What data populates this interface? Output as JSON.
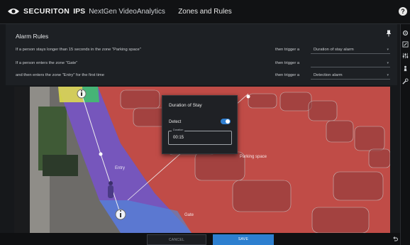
{
  "header": {
    "brand_name": "SECURITON",
    "brand_ips": "IPS",
    "brand_product": "NextGen VideoAnalytics",
    "title": "Zones and Rules",
    "help_glyph": "?"
  },
  "rules": {
    "title": "Alarm Rules",
    "rows": [
      {
        "condition": "If a person stays longer than 15 seconds in the zone \"Parking space\"",
        "trigger": "then trigger a",
        "alarm": "Duration of stay alarm"
      },
      {
        "condition": "If a person enters the zone \"Gate\"",
        "trigger": "then trigger a",
        "alarm": ""
      },
      {
        "condition": "and then enters the zone \"Entry\" for the first time",
        "trigger": "then trigger a",
        "alarm": "Detection alarm"
      }
    ],
    "dropdown_glyph": "▾"
  },
  "camera": {
    "zone_labels": {
      "parking": "Parking space",
      "entry": "Entry",
      "gate": "Gate"
    },
    "zone_colors": {
      "parking": "#e0403a",
      "entry": "#7a4fd8",
      "gate": "#4a8fe0",
      "yellow": "#e3e04a",
      "green": "#3ec46a"
    }
  },
  "dialog": {
    "title": "Duration of Stay",
    "detect_label": "Detect",
    "detect_enabled": true,
    "duration_caption": "Duration",
    "duration_value": "00:15"
  },
  "footer": {
    "cancel_label": "CANCEL",
    "save_label": "SAVE"
  },
  "icons": [
    "eye-logo-icon",
    "help-icon",
    "pin-icon",
    "settings-icon",
    "edit-icon",
    "sliders-icon",
    "person-icon",
    "tool-icon",
    "undo-icon",
    "info-marker-icon"
  ]
}
